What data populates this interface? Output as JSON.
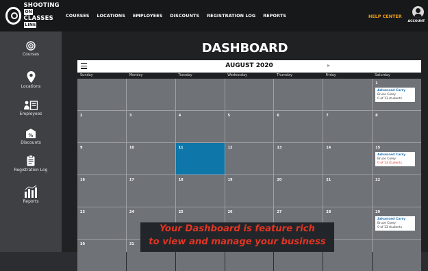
{
  "logo": {
    "line1": "SHOOTING",
    "line2": "CLASSES",
    "badge1": "ON",
    "badge2": "LINE"
  },
  "nav": [
    "COURSES",
    "LOCATIONS",
    "EMPLOYEES",
    "DISCOUNTS",
    "REGISTRATION LOG",
    "REPORTS"
  ],
  "help_center": "HELP CENTER",
  "account_label": "ACCOUNT",
  "sidebar": [
    {
      "label": "Courses",
      "icon": "target-icon"
    },
    {
      "label": "Locations",
      "icon": "map-pin-icon"
    },
    {
      "label": "Employees",
      "icon": "employees-icon"
    },
    {
      "label": "Discounts",
      "icon": "discount-tag-icon"
    },
    {
      "label": "Registration Log",
      "icon": "clipboard-icon"
    },
    {
      "label": "Reports",
      "icon": "bar-chart-icon"
    }
  ],
  "page_title": "DASHBOARD",
  "calendar": {
    "month": "AUGUST 2020",
    "day_names": [
      "Sunday",
      "Monday",
      "Tuesday",
      "Wednesday",
      "Thursday",
      "Friday",
      "Saturday"
    ],
    "weeks": [
      [
        "",
        "",
        "",
        "",
        "",
        "",
        "1"
      ],
      [
        "2",
        "3",
        "4",
        "5",
        "6",
        "7",
        "8"
      ],
      [
        "9",
        "10",
        "11",
        "12",
        "13",
        "14",
        "15"
      ],
      [
        "16",
        "17",
        "18",
        "19",
        "20",
        "21",
        "22"
      ],
      [
        "23",
        "24",
        "25",
        "26",
        "27",
        "28",
        "29"
      ],
      [
        "30",
        "31",
        "",
        "",
        "",
        "",
        ""
      ]
    ],
    "today": "11",
    "events": [
      {
        "date": "1",
        "title": "Advanced Carry",
        "instructor": "Bruce Corey",
        "status": "0 of 13 students",
        "status_color": "#333333"
      },
      {
        "date": "15",
        "title": "Advanced Carry",
        "instructor": "Bruce Corey",
        "status": "0 of 13 students",
        "status_color": "#d43b2f"
      },
      {
        "date": "29",
        "title": "Advanced Carry",
        "instructor": "Bruce Corey",
        "status": "0 of 13 students",
        "status_color": "#333333"
      }
    ]
  },
  "overlay": {
    "line1": "Your Dashboard is feature rich",
    "line2": "to view and manage your business"
  },
  "colors": {
    "accent": "#f2a01c",
    "today": "#0e76a8",
    "overlay_text": "#e8321e"
  }
}
